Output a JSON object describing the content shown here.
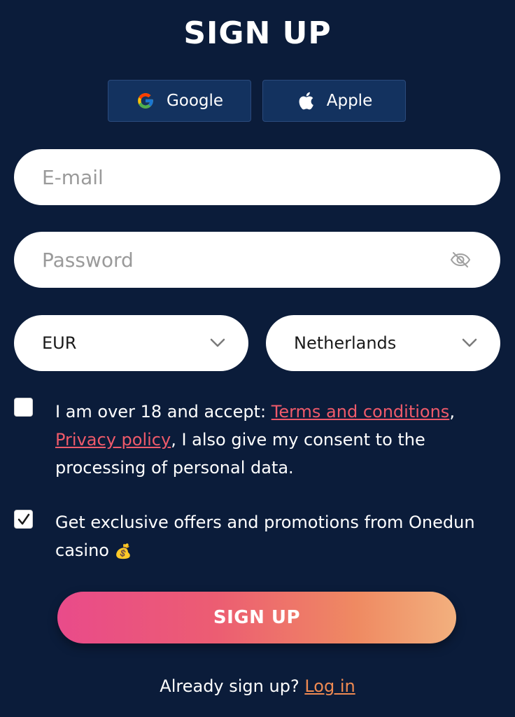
{
  "header": {
    "title": "SIGN UP"
  },
  "social": {
    "google_label": "Google",
    "apple_label": "Apple"
  },
  "form": {
    "email_placeholder": "E-mail",
    "email_value": "",
    "password_placeholder": "Password",
    "password_value": "",
    "currency": "EUR",
    "country": "Netherlands"
  },
  "consent": {
    "terms_checked": false,
    "terms_prefix": "I am over 18 and accept: ",
    "terms_link": "Terms and conditions",
    "terms_sep": ",",
    "privacy_link": "Privacy policy",
    "terms_suffix": ", I also give my consent to the processing of personal data.",
    "offers_checked": true,
    "offers_text": "Get exclusive offers and promotions from Onedun casino ",
    "offers_emoji": "💰"
  },
  "actions": {
    "signup_label": "SIGN UP"
  },
  "footer": {
    "prompt": "Already sign up? ",
    "login_link": "Log in"
  },
  "colors": {
    "background": "#0b1c3a",
    "social_button": "#13325f",
    "link_red": "#ef5a6a",
    "link_orange": "#ef8a52",
    "gradient_start": "#e94b8a",
    "gradient_end": "#f2b07e"
  },
  "icons": {
    "google": "google-icon",
    "apple": "apple-icon",
    "eye": "eye-slash-icon",
    "chevron": "chevron-down-icon",
    "check": "checkmark-icon"
  }
}
